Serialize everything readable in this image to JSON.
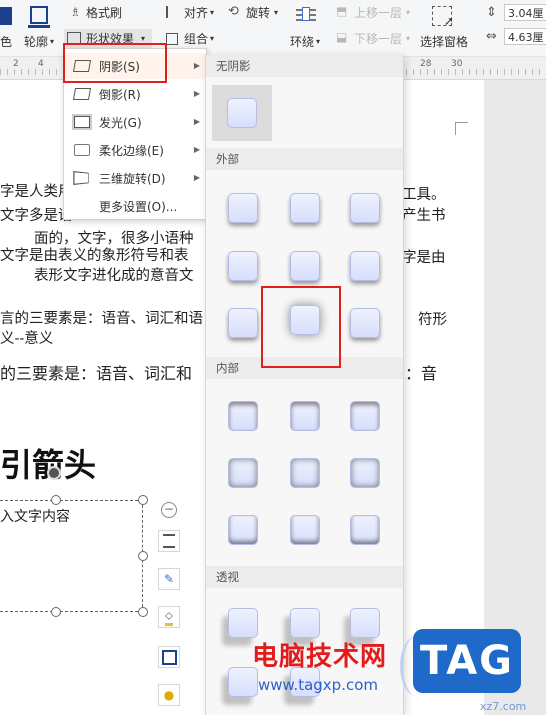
{
  "ribbon": {
    "format_painter": "格式刷",
    "align": "对齐",
    "rotate": "旋转",
    "move_up": "上移一层",
    "outline": "轮廓",
    "shape_effect": "形状效果",
    "group": "组合",
    "wrap": "环绕",
    "move_down": "下移一层",
    "selection_pane": "选择窗格",
    "left_cut": "色",
    "height_value": "3.04厘",
    "width_value": "4.63厘"
  },
  "ruler": {
    "ticks": [
      "2",
      "4",
      "28",
      "30"
    ]
  },
  "document": {
    "lines": [
      "字是人类用",
      "文字多是语",
      "面的，文字，很多小语种",
      "文字是由表义的象形符号和表",
      "表形文字进化成的意音文",
      "言的三要素是：语音、词汇和语",
      "义--意义",
      "的三要素是：语音、词汇和"
    ],
    "right_fragments": [
      "工具。",
      "产生书",
      "字是由",
      "符形",
      "：音"
    ],
    "heading": "引箭头",
    "textbox_text": "入文字内容"
  },
  "shape_menu": {
    "items": [
      {
        "label": "阴影(S)"
      },
      {
        "label": "倒影(R)"
      },
      {
        "label": "发光(G)"
      },
      {
        "label": "柔化边缘(E)"
      },
      {
        "label": "三维旋转(D)"
      },
      {
        "label": "更多设置(O)..."
      }
    ]
  },
  "gallery": {
    "no_shadow": "无阴影",
    "outer": "外部",
    "inner": "内部",
    "perspective": "透视"
  },
  "watermark": {
    "site_name": "电脑技术网",
    "url": "www.tagxp.com",
    "logo": "TAG",
    "corner": "xz7.com"
  },
  "colors": {
    "highlight_red": "#e0201b",
    "swatch_fill": "#dfe5fc",
    "watermark_blue": "#1f69c8"
  }
}
